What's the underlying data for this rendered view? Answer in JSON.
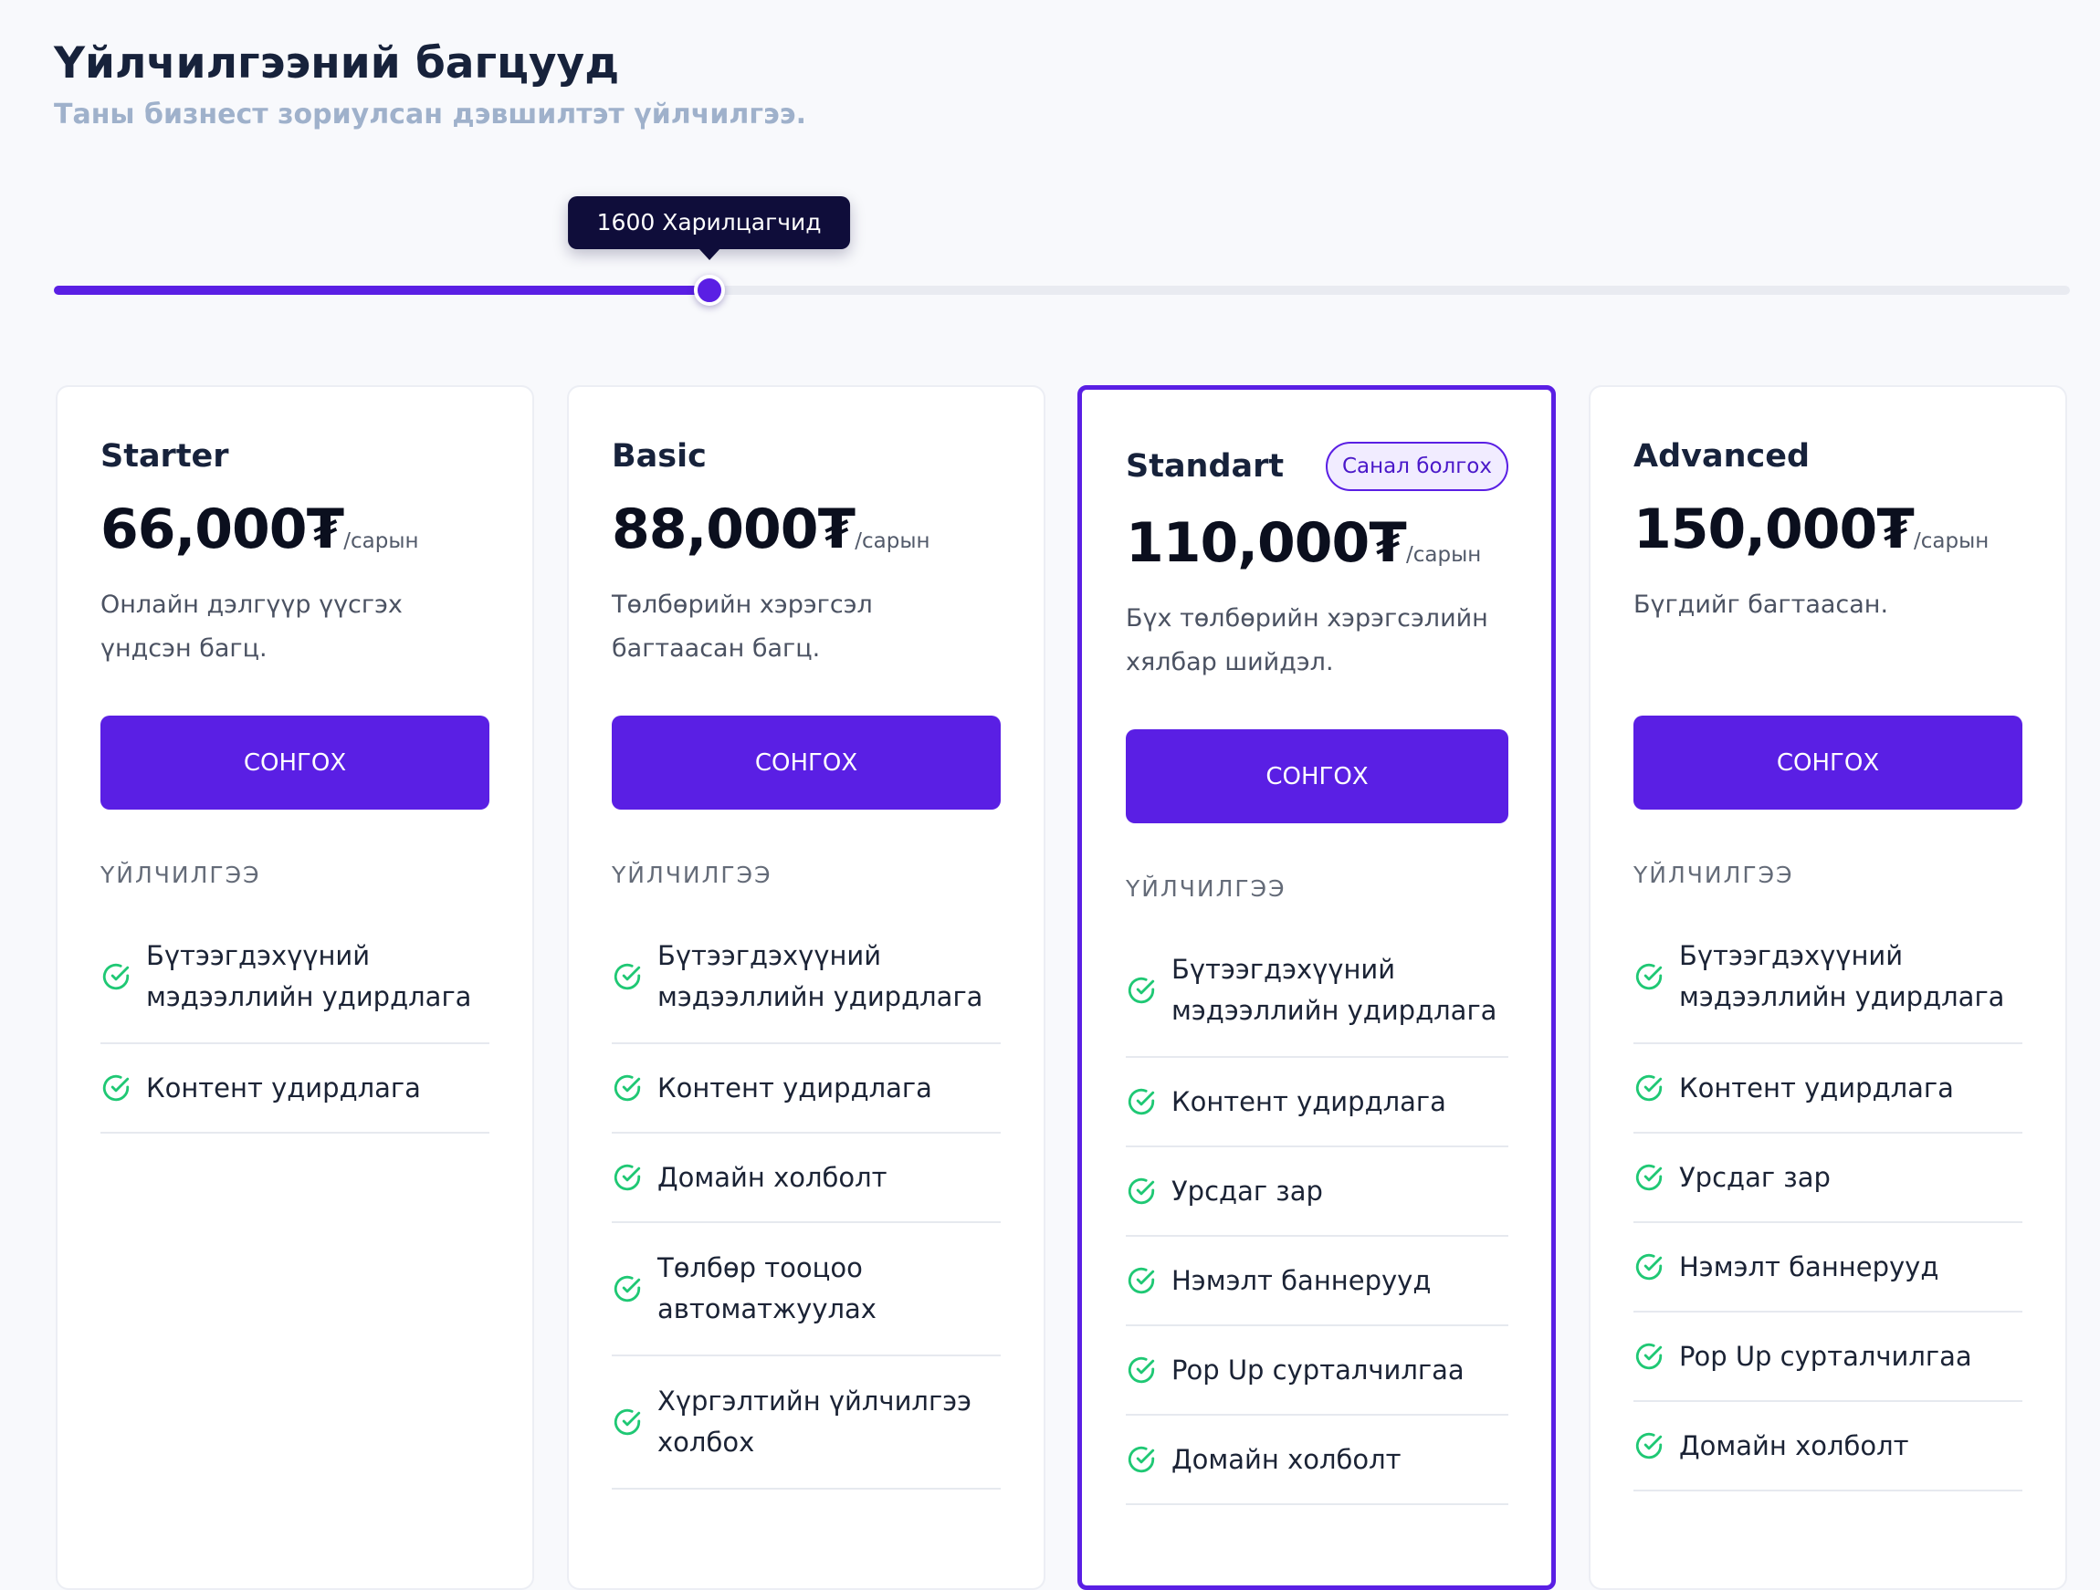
{
  "header": {
    "title": "Үйлчилгээний багцууд",
    "subtitle": "Таны бизнест зориулсан дэвшилтэт үйлчилгээ."
  },
  "slider": {
    "tooltip": "1600 Харилцагчид",
    "value_fraction": 0.325
  },
  "colors": {
    "accent": "#5a1fe4",
    "check": "#1fc874",
    "tooltip_bg": "#0f0d3a"
  },
  "icons": {
    "feature": "check-circle-icon"
  },
  "plans": [
    {
      "name": "Starter",
      "price": "66,000₮",
      "period": "/сарын",
      "description": "Онлайн дэлгүүр үүсгэх үндсэн багц.",
      "button": "СОНГОХ",
      "section_label": "ҮЙЛЧИЛГЭЭ",
      "features": [
        "Бүтээгдэхүүний мэдээллийн удирдлага",
        "Контент удирдлага"
      ]
    },
    {
      "name": "Basic",
      "price": "88,000₮",
      "period": "/сарын",
      "description": "Төлбөрийн хэрэгсэл багтаасан багц.",
      "button": "СОНГОХ",
      "section_label": "ҮЙЛЧИЛГЭЭ",
      "features": [
        "Бүтээгдэхүүний мэдээллийн удирдлага",
        "Контент удирдлага",
        "Домайн холболт",
        "Төлбөр тооцоо автоматжуулах",
        "Хүргэлтийн үйлчилгээ холбох"
      ]
    },
    {
      "name": "Standart",
      "badge": "Санал болгох",
      "price": "110,000₮",
      "period": "/сарын",
      "description": "Бүх төлбөрийн хэрэгсэлийн хялбар шийдэл.",
      "button": "СОНГОХ",
      "section_label": "ҮЙЛЧИЛГЭЭ",
      "features": [
        "Бүтээгдэхүүний мэдээллийн удирдлага",
        "Контент удирдлага",
        "Урсдаг зар",
        "Нэмэлт баннерууд",
        "Pop Up сурталчилгаа",
        "Домайн холболт"
      ]
    },
    {
      "name": "Advanced",
      "price": "150,000₮",
      "period": "/сарын",
      "description": "Бүгдийг багтаасан.",
      "button": "СОНГОХ",
      "section_label": "ҮЙЛЧИЛГЭЭ",
      "features": [
        "Бүтээгдэхүүний мэдээллийн удирдлага",
        "Контент удирдлага",
        "Урсдаг зар",
        "Нэмэлт баннерууд",
        "Pop Up сурталчилгаа",
        "Домайн холболт"
      ]
    }
  ]
}
